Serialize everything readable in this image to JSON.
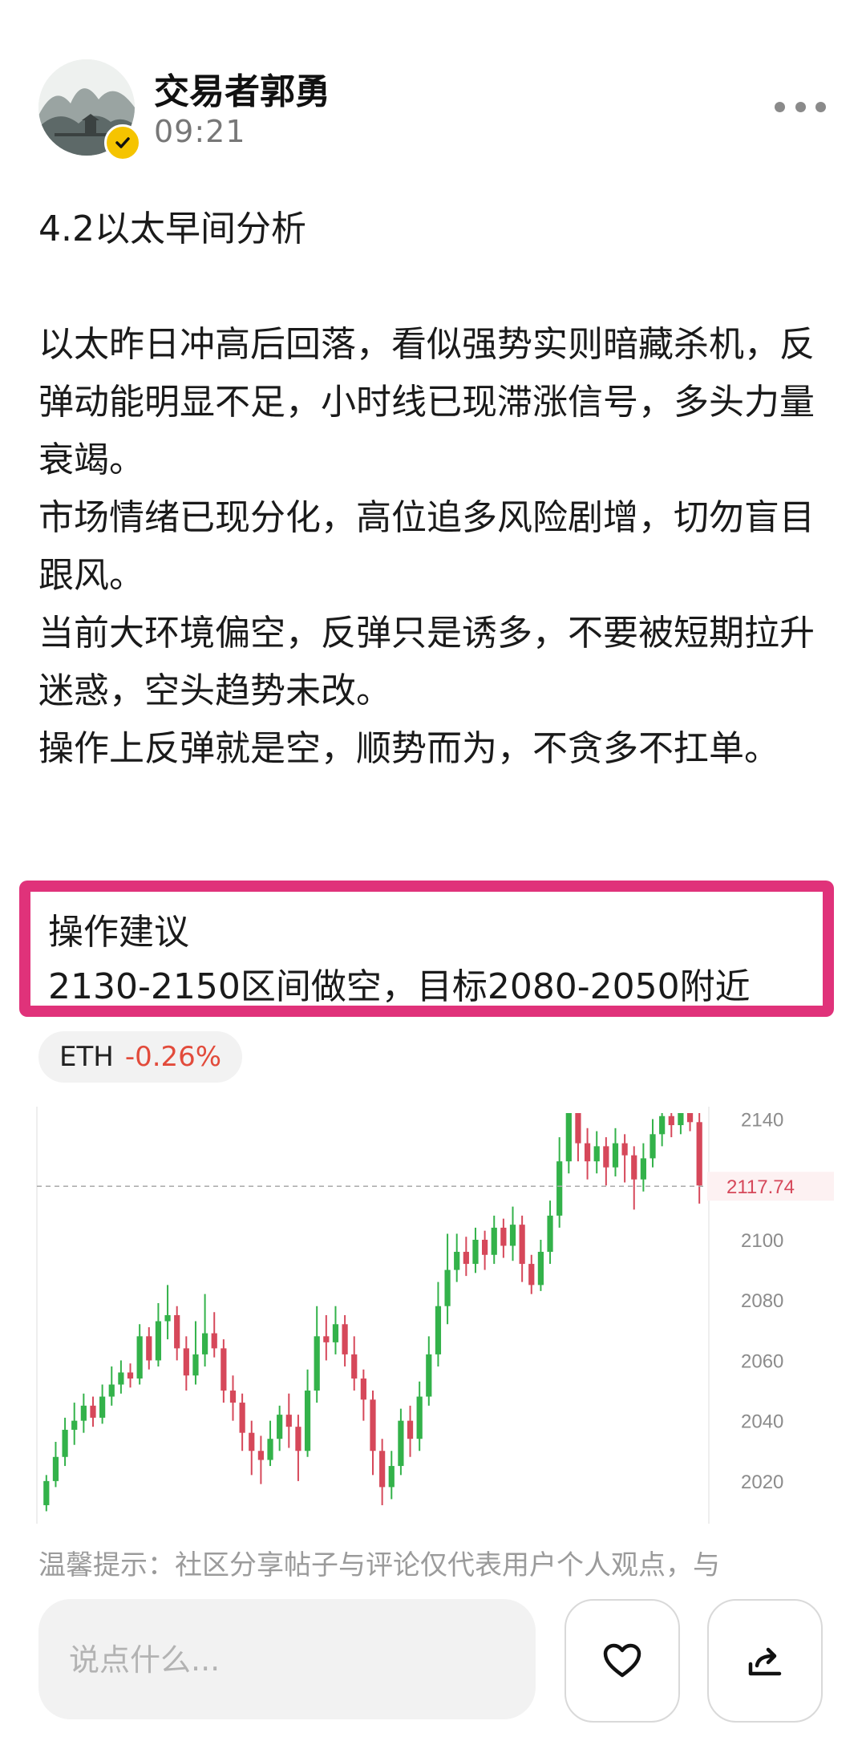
{
  "header": {
    "author_name": "交易者郭勇",
    "post_time": "09:21",
    "avatar_icon": "ink-landscape-avatar",
    "verified_icon": "verified-check-icon",
    "more_icon": "more-dots-icon"
  },
  "post": {
    "title": "4.2以太早间分析",
    "paragraphs": [
      "以太昨日冲高后回落，看似强势实则暗藏杀机，反弹动能明显不足，小时线已现滞涨信号，多头力量衰竭。",
      "市场情绪已现分化，高位追多风险剧增，切勿盲目跟风。",
      "当前大环境偏空，反弹只是诱多，不要被短期拉升迷惑，空头趋势未改。",
      "操作上反弹就是空，顺势而为，不贪多不扛单。"
    ]
  },
  "advice": {
    "heading": "操作建议",
    "detail": "2130-2150区间做空，目标2080-2050附近"
  },
  "ticker": {
    "symbol": "ETH",
    "change": "-0.26%"
  },
  "chart_data": {
    "type": "candlestick",
    "y_axis_ticks": [
      2140,
      2100,
      2080,
      2060,
      2040,
      2020
    ],
    "ylim": [
      2008,
      2142
    ],
    "current_price": "2117.74",
    "up_color": "#33b24a",
    "down_color": "#d6485a",
    "candles": [
      [
        2012,
        2020,
        2010,
        2022
      ],
      [
        2020,
        2028,
        2018,
        2033
      ],
      [
        2028,
        2037,
        2025,
        2041
      ],
      [
        2037,
        2040,
        2032,
        2046
      ],
      [
        2040,
        2045,
        2036,
        2049
      ],
      [
        2045,
        2041,
        2038,
        2048
      ],
      [
        2041,
        2048,
        2039,
        2052
      ],
      [
        2048,
        2052,
        2045,
        2058
      ],
      [
        2052,
        2056,
        2049,
        2060
      ],
      [
        2056,
        2054,
        2051,
        2059
      ],
      [
        2054,
        2068,
        2052,
        2072
      ],
      [
        2068,
        2060,
        2057,
        2071
      ],
      [
        2060,
        2073,
        2058,
        2079
      ],
      [
        2073,
        2075,
        2067,
        2085
      ],
      [
        2075,
        2064,
        2060,
        2078
      ],
      [
        2064,
        2055,
        2050,
        2068
      ],
      [
        2055,
        2062,
        2052,
        2073
      ],
      [
        2062,
        2069,
        2058,
        2082
      ],
      [
        2069,
        2064,
        2061,
        2076
      ],
      [
        2064,
        2050,
        2046,
        2067
      ],
      [
        2050,
        2046,
        2040,
        2055
      ],
      [
        2046,
        2036,
        2030,
        2049
      ],
      [
        2036,
        2030,
        2022,
        2040
      ],
      [
        2030,
        2027,
        2019,
        2035
      ],
      [
        2027,
        2034,
        2025,
        2040
      ],
      [
        2034,
        2042,
        2030,
        2045
      ],
      [
        2042,
        2038,
        2031,
        2049
      ],
      [
        2038,
        2030,
        2020,
        2042
      ],
      [
        2030,
        2050,
        2028,
        2057
      ],
      [
        2050,
        2068,
        2046,
        2078
      ],
      [
        2068,
        2066,
        2060,
        2075
      ],
      [
        2066,
        2072,
        2062,
        2078
      ],
      [
        2072,
        2062,
        2058,
        2075
      ],
      [
        2062,
        2054,
        2050,
        2068
      ],
      [
        2054,
        2047,
        2040,
        2057
      ],
      [
        2047,
        2030,
        2022,
        2050
      ],
      [
        2030,
        2018,
        2012,
        2034
      ],
      [
        2018,
        2025,
        2014,
        2030
      ],
      [
        2025,
        2040,
        2022,
        2044
      ],
      [
        2040,
        2034,
        2028,
        2045
      ],
      [
        2034,
        2048,
        2030,
        2053
      ],
      [
        2048,
        2062,
        2045,
        2068
      ],
      [
        2062,
        2078,
        2058,
        2086
      ],
      [
        2078,
        2090,
        2072,
        2102
      ],
      [
        2090,
        2096,
        2086,
        2102
      ],
      [
        2096,
        2092,
        2088,
        2101
      ],
      [
        2092,
        2100,
        2089,
        2104
      ],
      [
        2100,
        2095,
        2090,
        2103
      ],
      [
        2095,
        2104,
        2092,
        2108
      ],
      [
        2104,
        2098,
        2094,
        2107
      ],
      [
        2098,
        2105,
        2093,
        2111
      ],
      [
        2105,
        2092,
        2086,
        2108
      ],
      [
        2092,
        2085,
        2082,
        2095
      ],
      [
        2085,
        2096,
        2083,
        2100
      ],
      [
        2096,
        2108,
        2092,
        2113
      ],
      [
        2108,
        2126,
        2104,
        2134
      ],
      [
        2126,
        2142,
        2122,
        2142
      ],
      [
        2142,
        2132,
        2126,
        2142
      ],
      [
        2132,
        2126,
        2120,
        2137
      ],
      [
        2126,
        2131,
        2122,
        2136
      ],
      [
        2131,
        2124,
        2118,
        2134
      ],
      [
        2124,
        2132,
        2121,
        2137
      ],
      [
        2132,
        2128,
        2119,
        2135
      ],
      [
        2128,
        2120,
        2110,
        2131
      ],
      [
        2120,
        2127,
        2116,
        2132
      ],
      [
        2127,
        2135,
        2124,
        2140
      ],
      [
        2135,
        2141,
        2131,
        2142
      ],
      [
        2141,
        2138,
        2134,
        2142
      ],
      [
        2138,
        2142,
        2135,
        2142
      ],
      [
        2142,
        2139,
        2136,
        2142
      ],
      [
        2139,
        2118,
        2112,
        2142
      ]
    ]
  },
  "footer": {
    "disclaimer": "温馨提示：社区分享帖子与评论仅代表用户个人观点，与",
    "comment_placeholder": "说点什么...",
    "like_icon": "heart-icon",
    "share_icon": "share-icon"
  }
}
